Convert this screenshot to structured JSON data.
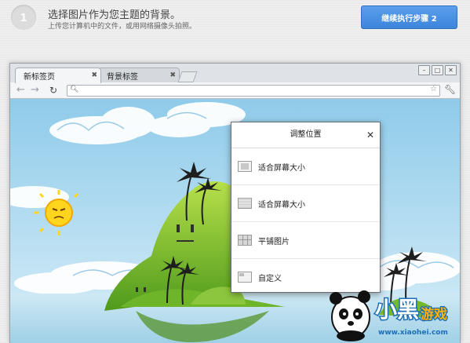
{
  "header": {
    "step_number": "1",
    "title": "选择图片作为您主题的背景。",
    "subtitle": "上传您计算机中的文件，或用网络摄像头拍照。",
    "next_button": "继续执行步骤 2"
  },
  "browser": {
    "tabs": [
      {
        "label": "新标签页",
        "active": true
      },
      {
        "label": "背景标签",
        "active": false
      }
    ],
    "omnibox_value": ""
  },
  "dialog": {
    "title": "调整位置",
    "options": [
      {
        "label": "适合屏幕大小",
        "icon": "fit-screen-icon"
      },
      {
        "label": "适合屏幕大小",
        "icon": "fill-screen-icon"
      },
      {
        "label": "平铺图片",
        "icon": "tile-icon"
      },
      {
        "label": "自定义",
        "icon": "custom-icon"
      }
    ]
  },
  "watermark": {
    "brand": "小黑游戏",
    "url": "www.xiaohei.com"
  },
  "colors": {
    "accent": "#4a90e2",
    "sky": "#a9d7ee",
    "island": "#8cc63f"
  }
}
